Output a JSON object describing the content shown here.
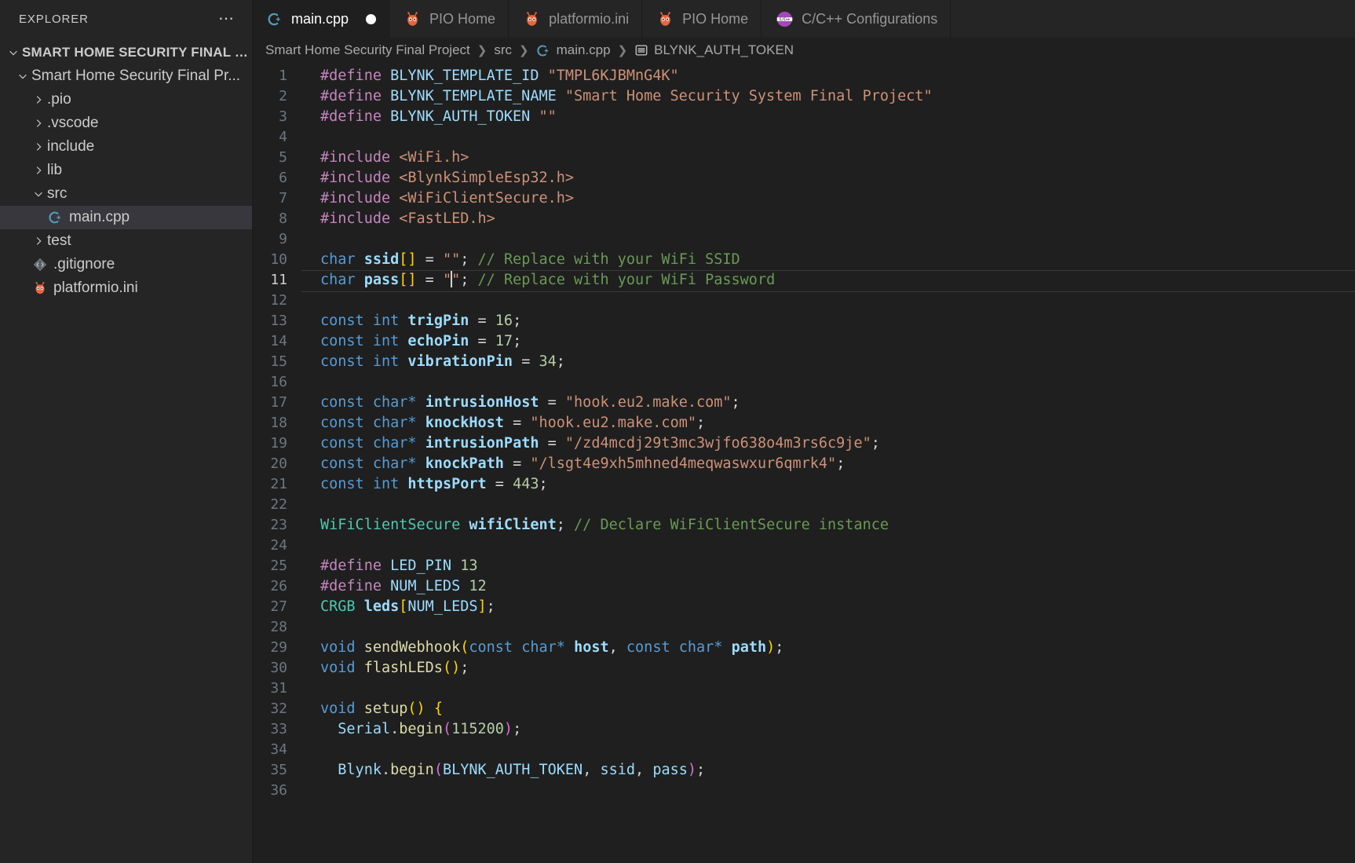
{
  "sidebar": {
    "header_title": "EXPLORER",
    "more_icon": "ellipsis-icon",
    "root_label": "SMART HOME SECURITY FINAL PR...",
    "project_label": "Smart Home Security Final Pr...",
    "items": [
      {
        "label": ".pio",
        "type": "folder",
        "expanded": false,
        "indent": 2
      },
      {
        "label": ".vscode",
        "type": "folder",
        "expanded": false,
        "indent": 2
      },
      {
        "label": "include",
        "type": "folder",
        "expanded": false,
        "indent": 2
      },
      {
        "label": "lib",
        "type": "folder",
        "expanded": false,
        "indent": 2
      },
      {
        "label": "src",
        "type": "folder",
        "expanded": true,
        "indent": 2
      },
      {
        "label": "main.cpp",
        "type": "cpp",
        "indent": 3,
        "selected": true
      },
      {
        "label": "test",
        "type": "folder",
        "expanded": false,
        "indent": 2
      },
      {
        "label": ".gitignore",
        "type": "git",
        "indent": 2
      },
      {
        "label": "platformio.ini",
        "type": "pio",
        "indent": 2
      }
    ]
  },
  "tabs": [
    {
      "label": "main.cpp",
      "icon": "cpp-file-icon",
      "active": true,
      "dirty": true
    },
    {
      "label": "PIO Home",
      "icon": "platformio-icon",
      "active": false,
      "dirty": false
    },
    {
      "label": "platformio.ini",
      "icon": "platformio-icon",
      "active": false,
      "dirty": false
    },
    {
      "label": "PIO Home",
      "icon": "platformio-icon",
      "active": false,
      "dirty": false
    },
    {
      "label": "C/C++ Configurations",
      "icon": "cpp-config-icon",
      "active": false,
      "dirty": false
    }
  ],
  "breadcrumb": [
    {
      "label": "Smart Home Security Final Project",
      "icon": ""
    },
    {
      "label": "src",
      "icon": ""
    },
    {
      "label": "main.cpp",
      "icon": "cpp-file-icon"
    },
    {
      "label": "BLYNK_AUTH_TOKEN",
      "icon": "symbol-macro-icon"
    }
  ],
  "editor": {
    "current_line": 11,
    "cursor_line": 11,
    "lines": [
      {
        "n": 1,
        "tokens": [
          [
            "t-pre",
            "#define"
          ],
          [
            "t-plain",
            " "
          ],
          [
            "t-id",
            "BLYNK_TEMPLATE_ID"
          ],
          [
            "t-plain",
            " "
          ],
          [
            "t-str",
            "\"TMPL6KJBMnG4K\""
          ]
        ]
      },
      {
        "n": 2,
        "tokens": [
          [
            "t-pre",
            "#define"
          ],
          [
            "t-plain",
            " "
          ],
          [
            "t-id",
            "BLYNK_TEMPLATE_NAME"
          ],
          [
            "t-plain",
            " "
          ],
          [
            "t-str",
            "\"Smart Home Security System Final Project\""
          ]
        ]
      },
      {
        "n": 3,
        "tokens": [
          [
            "t-pre",
            "#define"
          ],
          [
            "t-plain",
            " "
          ],
          [
            "t-id",
            "BLYNK_AUTH_TOKEN"
          ],
          [
            "t-plain",
            " "
          ],
          [
            "t-str",
            "\"\""
          ]
        ]
      },
      {
        "n": 4,
        "tokens": []
      },
      {
        "n": 5,
        "tokens": [
          [
            "t-pre",
            "#include"
          ],
          [
            "t-plain",
            " "
          ],
          [
            "t-str",
            "<WiFi.h>"
          ]
        ]
      },
      {
        "n": 6,
        "tokens": [
          [
            "t-pre",
            "#include"
          ],
          [
            "t-plain",
            " "
          ],
          [
            "t-str",
            "<BlynkSimpleEsp32.h>"
          ]
        ]
      },
      {
        "n": 7,
        "tokens": [
          [
            "t-pre",
            "#include"
          ],
          [
            "t-plain",
            " "
          ],
          [
            "t-str",
            "<WiFiClientSecure.h>"
          ]
        ]
      },
      {
        "n": 8,
        "tokens": [
          [
            "t-pre",
            "#include"
          ],
          [
            "t-plain",
            " "
          ],
          [
            "t-str",
            "<FastLED.h>"
          ]
        ]
      },
      {
        "n": 9,
        "tokens": []
      },
      {
        "n": 10,
        "tokens": [
          [
            "t-kw",
            "char"
          ],
          [
            "t-plain",
            " "
          ],
          [
            "t-id bold",
            "ssid"
          ],
          [
            "t-b1",
            "[]"
          ],
          [
            "t-plain",
            " = "
          ],
          [
            "t-str",
            "\"\""
          ],
          [
            "t-plain",
            ";"
          ],
          [
            "t-plain",
            " "
          ],
          [
            "t-com",
            "// Replace with your WiFi SSID"
          ]
        ]
      },
      {
        "n": 11,
        "tokens": [
          [
            "t-kw",
            "char"
          ],
          [
            "t-plain",
            " "
          ],
          [
            "t-id bold",
            "pass"
          ],
          [
            "t-b1",
            "[]"
          ],
          [
            "t-plain",
            " = "
          ],
          [
            "t-str",
            "\""
          ],
          [
            "CURSOR",
            ""
          ],
          [
            "t-str",
            "\""
          ],
          [
            "t-plain",
            ";"
          ],
          [
            "t-plain",
            " "
          ],
          [
            "t-com",
            "// Replace with your WiFi Password"
          ]
        ]
      },
      {
        "n": 12,
        "tokens": []
      },
      {
        "n": 13,
        "tokens": [
          [
            "t-kw",
            "const"
          ],
          [
            "t-plain",
            " "
          ],
          [
            "t-kw",
            "int"
          ],
          [
            "t-plain",
            " "
          ],
          [
            "t-id bold",
            "trigPin"
          ],
          [
            "t-plain",
            " = "
          ],
          [
            "t-num",
            "16"
          ],
          [
            "t-plain",
            ";"
          ]
        ]
      },
      {
        "n": 14,
        "tokens": [
          [
            "t-kw",
            "const"
          ],
          [
            "t-plain",
            " "
          ],
          [
            "t-kw",
            "int"
          ],
          [
            "t-plain",
            " "
          ],
          [
            "t-id bold",
            "echoPin"
          ],
          [
            "t-plain",
            " = "
          ],
          [
            "t-num",
            "17"
          ],
          [
            "t-plain",
            ";"
          ]
        ]
      },
      {
        "n": 15,
        "tokens": [
          [
            "t-kw",
            "const"
          ],
          [
            "t-plain",
            " "
          ],
          [
            "t-kw",
            "int"
          ],
          [
            "t-plain",
            " "
          ],
          [
            "t-id bold",
            "vibrationPin"
          ],
          [
            "t-plain",
            " = "
          ],
          [
            "t-num",
            "34"
          ],
          [
            "t-plain",
            ";"
          ]
        ]
      },
      {
        "n": 16,
        "tokens": []
      },
      {
        "n": 17,
        "tokens": [
          [
            "t-kw",
            "const"
          ],
          [
            "t-plain",
            " "
          ],
          [
            "t-kw",
            "char*"
          ],
          [
            "t-plain",
            " "
          ],
          [
            "t-id bold",
            "intrusionHost"
          ],
          [
            "t-plain",
            " = "
          ],
          [
            "t-str",
            "\"hook.eu2.make.com\""
          ],
          [
            "t-plain",
            ";"
          ]
        ]
      },
      {
        "n": 18,
        "tokens": [
          [
            "t-kw",
            "const"
          ],
          [
            "t-plain",
            " "
          ],
          [
            "t-kw",
            "char*"
          ],
          [
            "t-plain",
            " "
          ],
          [
            "t-id bold",
            "knockHost"
          ],
          [
            "t-plain",
            " = "
          ],
          [
            "t-str",
            "\"hook.eu2.make.com\""
          ],
          [
            "t-plain",
            ";"
          ]
        ]
      },
      {
        "n": 19,
        "tokens": [
          [
            "t-kw",
            "const"
          ],
          [
            "t-plain",
            " "
          ],
          [
            "t-kw",
            "char*"
          ],
          [
            "t-plain",
            " "
          ],
          [
            "t-id bold",
            "intrusionPath"
          ],
          [
            "t-plain",
            " = "
          ],
          [
            "t-str",
            "\"/zd4mcdj29t3mc3wjfo638o4m3rs6c9je\""
          ],
          [
            "t-plain",
            ";"
          ]
        ]
      },
      {
        "n": 20,
        "tokens": [
          [
            "t-kw",
            "const"
          ],
          [
            "t-plain",
            " "
          ],
          [
            "t-kw",
            "char*"
          ],
          [
            "t-plain",
            " "
          ],
          [
            "t-id bold",
            "knockPath"
          ],
          [
            "t-plain",
            " = "
          ],
          [
            "t-str",
            "\"/lsgt4e9xh5mhned4meqwaswxur6qmrk4\""
          ],
          [
            "t-plain",
            ";"
          ]
        ]
      },
      {
        "n": 21,
        "tokens": [
          [
            "t-kw",
            "const"
          ],
          [
            "t-plain",
            " "
          ],
          [
            "t-kw",
            "int"
          ],
          [
            "t-plain",
            " "
          ],
          [
            "t-id bold",
            "httpsPort"
          ],
          [
            "t-plain",
            " = "
          ],
          [
            "t-num",
            "443"
          ],
          [
            "t-plain",
            ";"
          ]
        ]
      },
      {
        "n": 22,
        "tokens": []
      },
      {
        "n": 23,
        "tokens": [
          [
            "t-type",
            "WiFiClientSecure"
          ],
          [
            "t-plain",
            " "
          ],
          [
            "t-id bold",
            "wifiClient"
          ],
          [
            "t-plain",
            ";"
          ],
          [
            "t-plain",
            " "
          ],
          [
            "t-com",
            "// Declare WiFiClientSecure instance"
          ]
        ]
      },
      {
        "n": 24,
        "tokens": []
      },
      {
        "n": 25,
        "tokens": [
          [
            "t-pre",
            "#define"
          ],
          [
            "t-plain",
            " "
          ],
          [
            "t-id",
            "LED_PIN"
          ],
          [
            "t-plain",
            " "
          ],
          [
            "t-num",
            "13"
          ]
        ]
      },
      {
        "n": 26,
        "tokens": [
          [
            "t-pre",
            "#define"
          ],
          [
            "t-plain",
            " "
          ],
          [
            "t-id",
            "NUM_LEDS"
          ],
          [
            "t-plain",
            " "
          ],
          [
            "t-num",
            "12"
          ]
        ]
      },
      {
        "n": 27,
        "tokens": [
          [
            "t-type",
            "CRGB"
          ],
          [
            "t-plain",
            " "
          ],
          [
            "t-id bold",
            "leds"
          ],
          [
            "t-b1",
            "["
          ],
          [
            "t-id",
            "NUM_LEDS"
          ],
          [
            "t-b1",
            "]"
          ],
          [
            "t-plain",
            ";"
          ]
        ]
      },
      {
        "n": 28,
        "tokens": []
      },
      {
        "n": 29,
        "tokens": [
          [
            "t-kw",
            "void"
          ],
          [
            "t-plain",
            " "
          ],
          [
            "t-fn",
            "sendWebhook"
          ],
          [
            "t-b1",
            "("
          ],
          [
            "t-kw",
            "const"
          ],
          [
            "t-plain",
            " "
          ],
          [
            "t-kw",
            "char*"
          ],
          [
            "t-plain",
            " "
          ],
          [
            "t-id bold",
            "host"
          ],
          [
            "t-plain",
            ", "
          ],
          [
            "t-kw",
            "const"
          ],
          [
            "t-plain",
            " "
          ],
          [
            "t-kw",
            "char*"
          ],
          [
            "t-plain",
            " "
          ],
          [
            "t-id bold",
            "path"
          ],
          [
            "t-b1",
            ")"
          ],
          [
            "t-plain",
            ";"
          ]
        ]
      },
      {
        "n": 30,
        "tokens": [
          [
            "t-kw",
            "void"
          ],
          [
            "t-plain",
            " "
          ],
          [
            "t-fn",
            "flashLEDs"
          ],
          [
            "t-b1",
            "()"
          ],
          [
            "t-plain",
            ";"
          ]
        ]
      },
      {
        "n": 31,
        "tokens": []
      },
      {
        "n": 32,
        "tokens": [
          [
            "t-kw",
            "void"
          ],
          [
            "t-plain",
            " "
          ],
          [
            "t-fn",
            "setup"
          ],
          [
            "t-b1",
            "()"
          ],
          [
            "t-plain",
            " "
          ],
          [
            "t-b1",
            "{"
          ]
        ]
      },
      {
        "n": 33,
        "tokens": [
          [
            "t-plain",
            "  "
          ],
          [
            "t-id",
            "Serial"
          ],
          [
            "t-plain",
            "."
          ],
          [
            "t-fn",
            "begin"
          ],
          [
            "t-b2",
            "("
          ],
          [
            "t-num",
            "115200"
          ],
          [
            "t-b2",
            ")"
          ],
          [
            "t-plain",
            ";"
          ]
        ]
      },
      {
        "n": 34,
        "tokens": []
      },
      {
        "n": 35,
        "tokens": [
          [
            "t-plain",
            "  "
          ],
          [
            "t-id",
            "Blynk"
          ],
          [
            "t-plain",
            "."
          ],
          [
            "t-fn",
            "begin"
          ],
          [
            "t-b2",
            "("
          ],
          [
            "t-id",
            "BLYNK_AUTH_TOKEN"
          ],
          [
            "t-plain",
            ", "
          ],
          [
            "t-id",
            "ssid"
          ],
          [
            "t-plain",
            ", "
          ],
          [
            "t-id",
            "pass"
          ],
          [
            "t-b2",
            ")"
          ],
          [
            "t-plain",
            ";"
          ]
        ]
      },
      {
        "n": 36,
        "tokens": []
      }
    ]
  },
  "colors": {
    "bg_editor": "#1f1f1f",
    "bg_sidebar": "#252526",
    "selection": "#37373d",
    "accent_cpp": "#519aba",
    "accent_pio": "#e8663c",
    "accent_cppconfig": "#a347ba"
  }
}
